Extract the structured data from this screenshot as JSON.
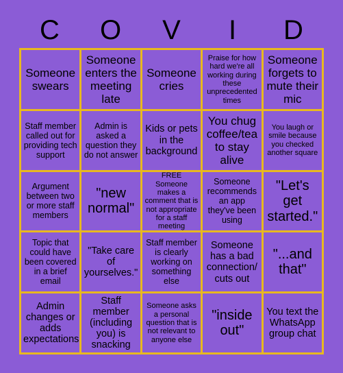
{
  "header": {
    "letters": [
      "C",
      "O",
      "V",
      "I",
      "D"
    ]
  },
  "grid": {
    "rows": 5,
    "columns": 5,
    "border_color": "#E8B820",
    "cell_background": "#8B5CD6",
    "text_color": "#000000",
    "page_background": "#8B5CD6",
    "cells": [
      {
        "text": "Someone swears",
        "size": "lg"
      },
      {
        "text": "Someone enters the meeting late",
        "size": "lg"
      },
      {
        "text": "Someone cries",
        "size": "lg"
      },
      {
        "text": "Praise for how hard we're all working during these unprecedented times",
        "size": "xs"
      },
      {
        "text": "Someone forgets to mute their mic",
        "size": "lg"
      },
      {
        "text": "Staff member called out for providing tech support",
        "size": "sm"
      },
      {
        "text": "Admin is asked a question they do not answer",
        "size": "sm"
      },
      {
        "text": "Kids or pets in the background",
        "size": "md"
      },
      {
        "text": "You chug coffee/tea to stay alive",
        "size": "lg"
      },
      {
        "text": "You laugh or smile because you checked another square",
        "size": "xs"
      },
      {
        "text": "Argument between two or more staff members",
        "size": "sm"
      },
      {
        "text": "\"new normal\"",
        "size": "xl"
      },
      {
        "text": "FREE",
        "body": "Someone makes a comment that is not appropriate for a staff meeting",
        "size": "free",
        "free": true
      },
      {
        "text": "Someone recommends an app they've been using",
        "size": "sm"
      },
      {
        "text": "\"Let's get started.\"",
        "size": "xl"
      },
      {
        "text": "Topic that could have been covered in a brief email",
        "size": "sm"
      },
      {
        "text": "\"Take care of yourselves.\"",
        "size": "md"
      },
      {
        "text": "Staff member is clearly working on something else",
        "size": "sm"
      },
      {
        "text": "Someone has a bad connection/ cuts out",
        "size": "md"
      },
      {
        "text": "\"...and that\"",
        "size": "xl"
      },
      {
        "text": "Admin changes or adds expectations",
        "size": "md"
      },
      {
        "text": "Staff member (including you) is snacking",
        "size": "md"
      },
      {
        "text": "Someone asks a personal question that is not relevant to anyone else",
        "size": "xs"
      },
      {
        "text": "\"inside out\"",
        "size": "xl"
      },
      {
        "text": "You text the WhatsApp group chat",
        "size": "md"
      }
    ]
  }
}
